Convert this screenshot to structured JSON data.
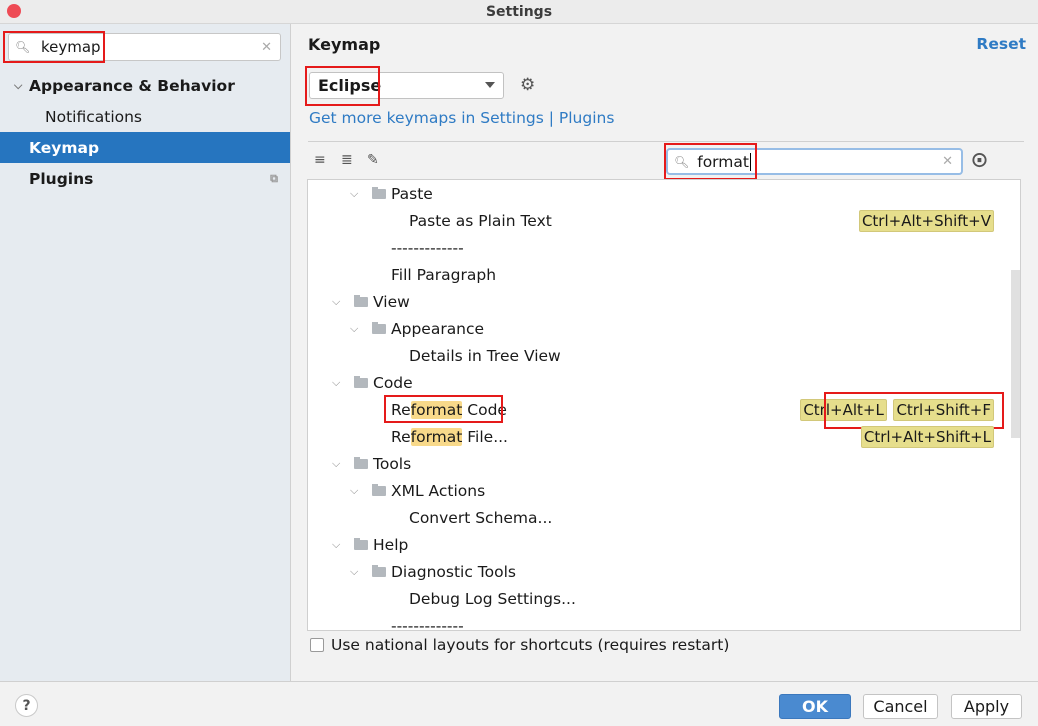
{
  "window": {
    "title": "Settings"
  },
  "sidebar": {
    "search": {
      "value": "keymap"
    },
    "items": [
      {
        "label": "Appearance & Behavior",
        "expanded": true,
        "bold": true
      },
      {
        "label": "Notifications",
        "bold": false
      },
      {
        "label": "Keymap",
        "selected": true,
        "bold": true
      },
      {
        "label": "Plugins",
        "bold": true
      }
    ]
  },
  "main": {
    "title": "Keymap",
    "reset_label": "Reset",
    "keymap_select": {
      "value": "Eclipse"
    },
    "more_link": "Get more keymaps in Settings | Plugins",
    "search": {
      "value": "format"
    },
    "tree": [
      {
        "level": 1,
        "type": "folder",
        "label": "Paste",
        "expanded": true
      },
      {
        "level": 2,
        "type": "action",
        "label": "Paste as Plain Text",
        "shortcuts": [
          "Ctrl+Alt+Shift+V"
        ]
      },
      {
        "level": 1,
        "type": "separator",
        "label": "-------------"
      },
      {
        "level": 1,
        "type": "action",
        "label": "Fill Paragraph"
      },
      {
        "level": 0,
        "type": "folder",
        "label": "View",
        "expanded": true
      },
      {
        "level": 1,
        "type": "folder",
        "label": "Appearance",
        "expanded": true
      },
      {
        "level": 2,
        "type": "action",
        "label": "Details in Tree View"
      },
      {
        "level": 0,
        "type": "folder",
        "label": "Code",
        "expanded": true
      },
      {
        "level": 1,
        "type": "action",
        "label_pre": "Re",
        "label_hl": "format",
        "label_post": " Code",
        "shortcuts": [
          "Ctrl+Alt+L",
          "Ctrl+Shift+F"
        ]
      },
      {
        "level": 1,
        "type": "action",
        "label_pre": "Re",
        "label_hl": "format",
        "label_post": " File...",
        "shortcuts": [
          "Ctrl+Alt+Shift+L"
        ]
      },
      {
        "level": 0,
        "type": "folder",
        "label": "Tools",
        "expanded": true
      },
      {
        "level": 1,
        "type": "folder",
        "label": "XML Actions",
        "expanded": true
      },
      {
        "level": 2,
        "type": "action",
        "label": "Convert Schema..."
      },
      {
        "level": 0,
        "type": "folder",
        "label": "Help",
        "expanded": true
      },
      {
        "level": 1,
        "type": "folder",
        "label": "Diagnostic Tools",
        "expanded": true
      },
      {
        "level": 2,
        "type": "action",
        "label": "Debug Log Settings..."
      },
      {
        "level": 1,
        "type": "separator",
        "label": "-------------"
      }
    ],
    "national_layouts": {
      "label": "Use national layouts for shortcuts (requires restart)",
      "checked": false
    }
  },
  "footer": {
    "help": "?",
    "ok": "OK",
    "cancel": "Cancel",
    "apply": "Apply"
  },
  "colors": {
    "accent": "#2675bf",
    "link": "#2f7bc4",
    "highlight": "#f8d98a",
    "shortcut_bg": "#e6de8c",
    "annotation": "#e51a1a"
  }
}
